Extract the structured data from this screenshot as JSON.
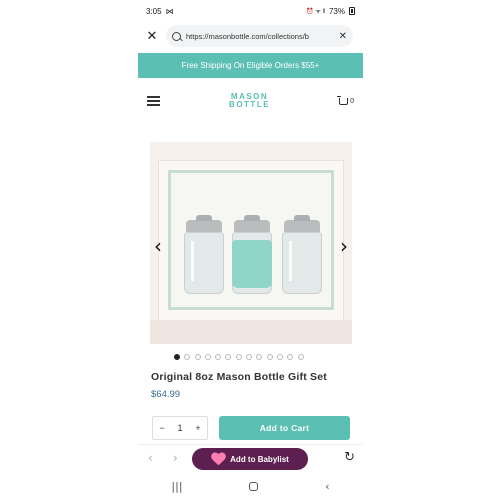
{
  "status_bar": {
    "time": "3:05",
    "time_extra": "⋈",
    "battery_text": "73%",
    "signal_icons": "⏰ ᯤ ‖"
  },
  "browser": {
    "url": "https://masonbottle.com/collections/b",
    "close_glyph": "✕",
    "clear_glyph": "✕"
  },
  "banner": {
    "text": "Free Shipping On Eligible Orders $55+"
  },
  "header": {
    "logo_line1": "MASON",
    "logo_line2": "BOTTLE",
    "cart_count": "0"
  },
  "carousel": {
    "prev_glyph": "‹",
    "next_glyph": "›",
    "dot_count": 13,
    "active_index": 0
  },
  "product": {
    "title": "Original 8oz Mason Bottle Gift Set",
    "price": "$64.99",
    "quantity": "1",
    "minus": "−",
    "plus": "+",
    "add_to_cart": "Add to Cart"
  },
  "browser_bar": {
    "back": "‹",
    "forward": "›",
    "babylist_label": "Add to Babylist",
    "refresh": "↻"
  },
  "android_nav": {
    "recents": "|||",
    "back": "‹"
  },
  "colors": {
    "accent": "#5bbfb3",
    "price": "#3a6b8c",
    "babylist": "#5c1f4f"
  },
  "icons": [
    "search-icon",
    "close-icon",
    "hamburger-icon",
    "cart-icon",
    "heart-icon",
    "refresh-icon",
    "home-icon"
  ]
}
